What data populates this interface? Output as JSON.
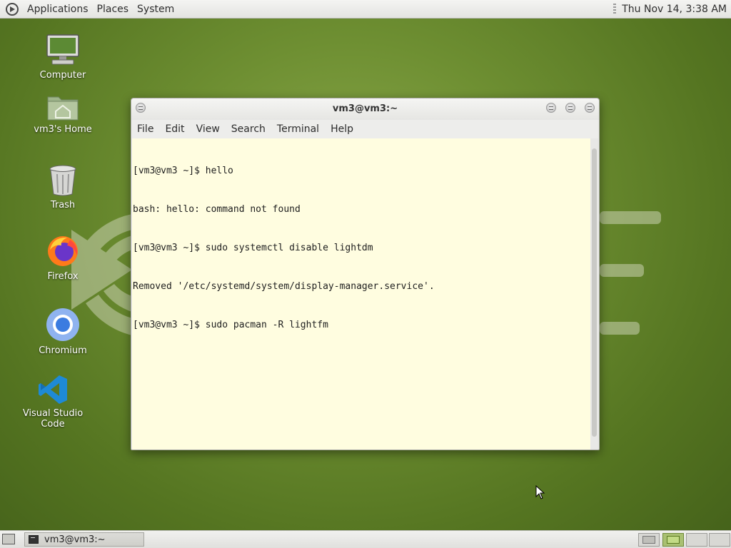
{
  "top_panel": {
    "menus": [
      "Applications",
      "Places",
      "System"
    ],
    "clock": "Thu Nov 14,  3:38 AM"
  },
  "desktop_icons": [
    {
      "label": "Computer",
      "icon": "computer-icon"
    },
    {
      "label": "vm3's Home",
      "icon": "home-folder-icon"
    },
    {
      "label": "Trash",
      "icon": "trash-icon"
    },
    {
      "label": "Firefox",
      "icon": "firefox-icon"
    },
    {
      "label": "Chromium",
      "icon": "chromium-icon"
    },
    {
      "label": "Visual Studio Code",
      "icon": "vscode-icon"
    }
  ],
  "terminal": {
    "title": "vm3@vm3:~",
    "menu": [
      "File",
      "Edit",
      "View",
      "Search",
      "Terminal",
      "Help"
    ],
    "lines": [
      "[vm3@vm3 ~]$ hello",
      "bash: hello: command not found",
      "[vm3@vm3 ~]$ sudo systemctl disable lightdm",
      "Removed '/etc/systemd/system/display-manager.service'.",
      "[vm3@vm3 ~]$ sudo pacman -R lightfm"
    ],
    "background": "#fffde0"
  },
  "taskbar": {
    "task_label": "vm3@vm3:~",
    "workspaces": 4,
    "active_workspace": 2
  },
  "colors": {
    "desktop": "#6e8f32",
    "accent": "#a9c072"
  }
}
